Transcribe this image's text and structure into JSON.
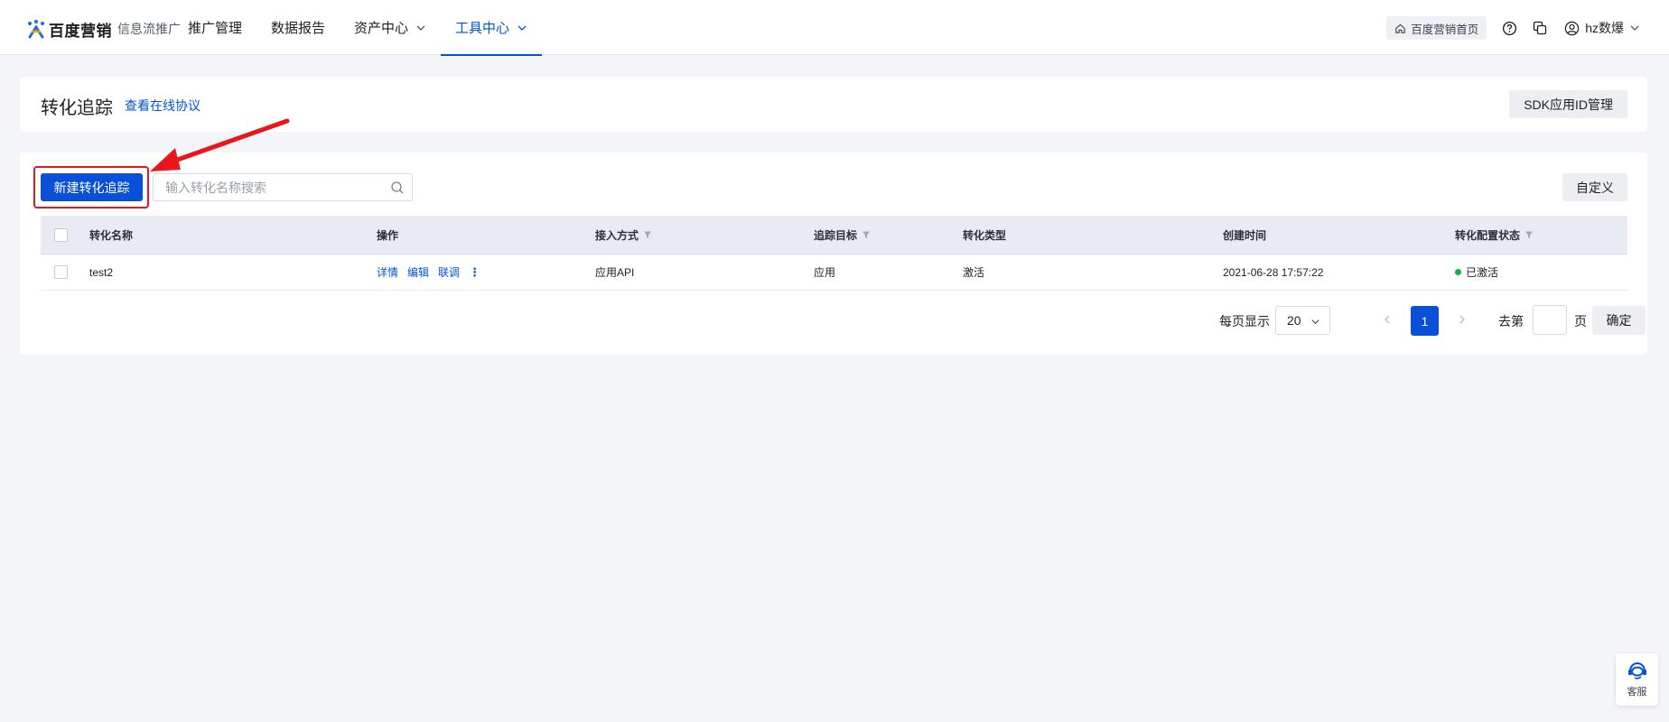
{
  "brand": {
    "name": "百度营销",
    "product": "信息流推广"
  },
  "nav": {
    "items": [
      {
        "label": "推广管理",
        "has_dropdown": false,
        "active": false
      },
      {
        "label": "数据报告",
        "has_dropdown": false,
        "active": false
      },
      {
        "label": "资产中心",
        "has_dropdown": true,
        "active": false
      },
      {
        "label": "工具中心",
        "has_dropdown": true,
        "active": true
      }
    ]
  },
  "top_right": {
    "home_label": "百度营销首页",
    "help_icon": "question-circle-icon",
    "switch_icon": "copy-icon",
    "user_name": "hz数爆"
  },
  "header": {
    "title": "转化追踪",
    "protocol_link": "查看在线协议",
    "sdk_button": "SDK应用ID管理"
  },
  "toolbar": {
    "create_button": "新建转化追踪",
    "search_placeholder": "输入转化名称搜索",
    "custom_button": "自定义"
  },
  "table": {
    "columns": [
      {
        "label": "转化名称",
        "filter": false
      },
      {
        "label": "操作",
        "filter": false
      },
      {
        "label": "接入方式",
        "filter": true
      },
      {
        "label": "追踪目标",
        "filter": true
      },
      {
        "label": "转化类型",
        "filter": false
      },
      {
        "label": "创建时间",
        "filter": false
      },
      {
        "label": "转化配置状态",
        "filter": true
      }
    ],
    "rows": [
      {
        "name": "test2",
        "actions": [
          "详情",
          "编辑",
          "联调"
        ],
        "more": "⋮",
        "access": "应用API",
        "target": "应用",
        "type": "激活",
        "created": "2021-06-28 17:57:22",
        "status": "已激活"
      }
    ]
  },
  "pagination": {
    "page_size_label": "每页显示",
    "page_size": "20",
    "current_page": "1",
    "goto_label": "去第",
    "page_unit": "页",
    "confirm": "确定"
  },
  "service": {
    "label": "客服"
  },
  "colors": {
    "primary": "#0a4fd8",
    "link": "#0052d9",
    "annotation": "#e8161d",
    "status_active": "#10b34a"
  }
}
